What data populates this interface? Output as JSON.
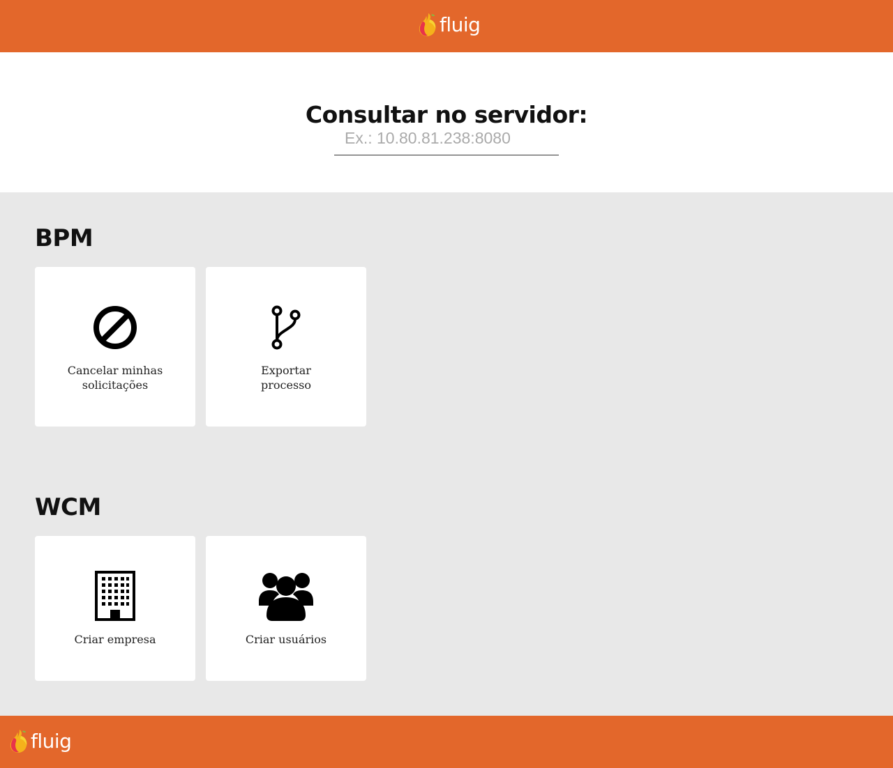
{
  "header": {
    "logo_text": "fluig"
  },
  "search": {
    "title": "Consultar no servidor:",
    "placeholder": "Ex.: 10.80.81.238:8080",
    "value": ""
  },
  "sections": [
    {
      "title": "BPM",
      "cards": [
        {
          "label_lines": [
            "Cancelar minhas",
            "solicitações"
          ],
          "icon": "ban-icon"
        },
        {
          "label_lines": [
            "Exportar",
            "processo"
          ],
          "icon": "code-fork-icon"
        }
      ]
    },
    {
      "title": "WCM",
      "cards": [
        {
          "label_lines": [
            "Criar empresa"
          ],
          "icon": "building-icon"
        },
        {
          "label_lines": [
            "Criar usuários"
          ],
          "icon": "users-icon"
        }
      ]
    }
  ],
  "footer": {
    "logo_text": "fluig"
  },
  "colors": {
    "brand_orange": "#e3672b",
    "background_gray": "#e8e8e8",
    "card_white": "#ffffff"
  }
}
